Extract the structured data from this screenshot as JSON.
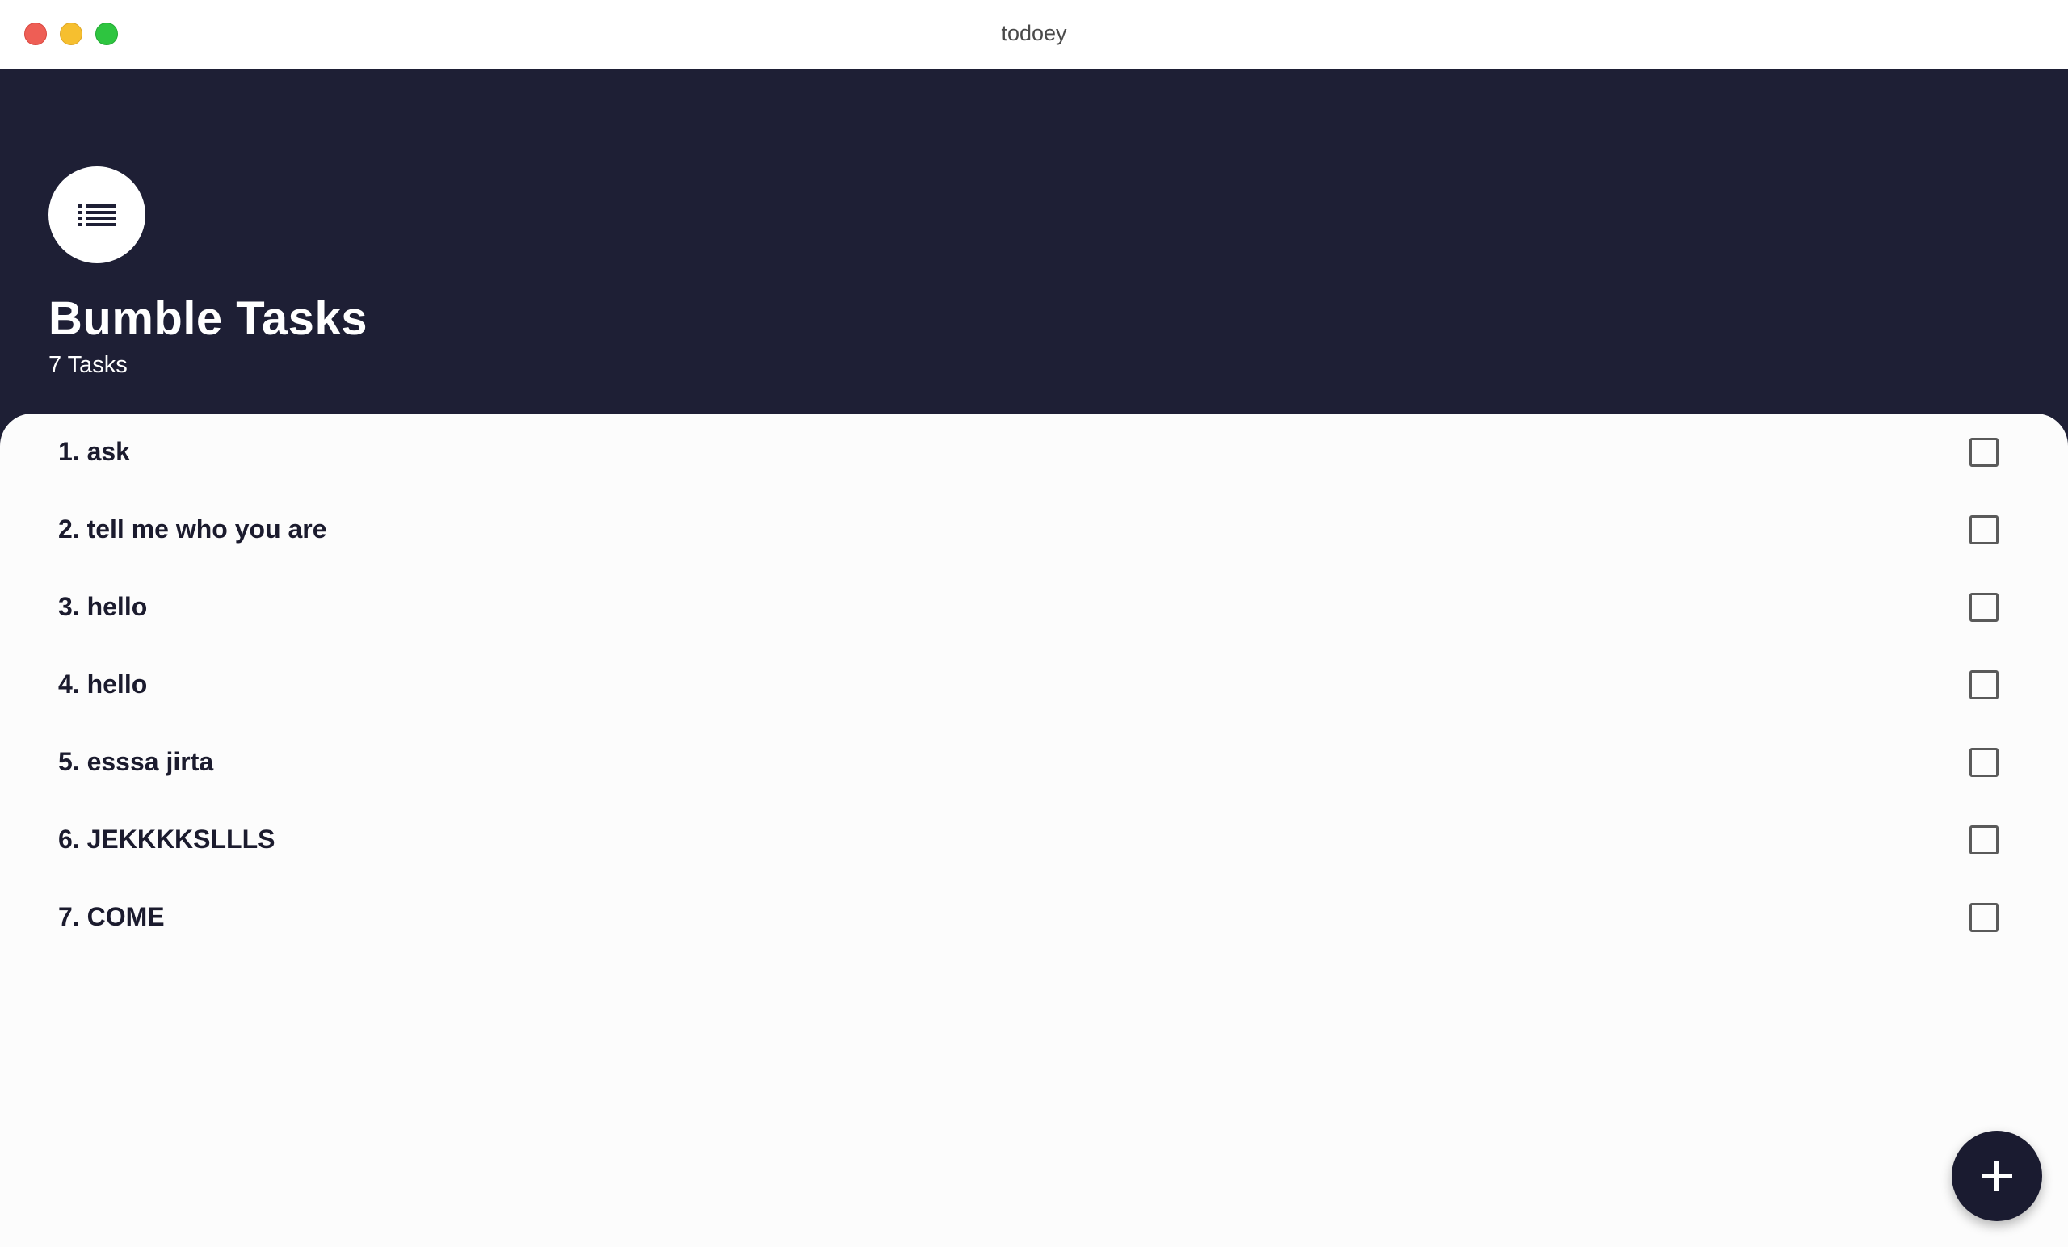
{
  "window": {
    "title": "todoey"
  },
  "header": {
    "icon": "list-icon",
    "title": "Bumble Tasks",
    "count_text": "7 Tasks"
  },
  "tasks": [
    {
      "label": "1. ask",
      "checked": false
    },
    {
      "label": "2. tell me who you are",
      "checked": false
    },
    {
      "label": "3. hello",
      "checked": false
    },
    {
      "label": "4. hello",
      "checked": false
    },
    {
      "label": "5. esssa jirta",
      "checked": false
    },
    {
      "label": "6. JEKKKKSLLLS",
      "checked": false
    },
    {
      "label": "7. COME",
      "checked": false
    }
  ],
  "fab": {
    "icon": "plus-icon"
  },
  "colors": {
    "header_bg": "#1e1f35",
    "sheet_bg": "#fcfcfc",
    "fab_bg": "#1a1b30",
    "close": "#ee5e55",
    "minimize": "#f6bf2f",
    "zoom": "#2ec540"
  }
}
